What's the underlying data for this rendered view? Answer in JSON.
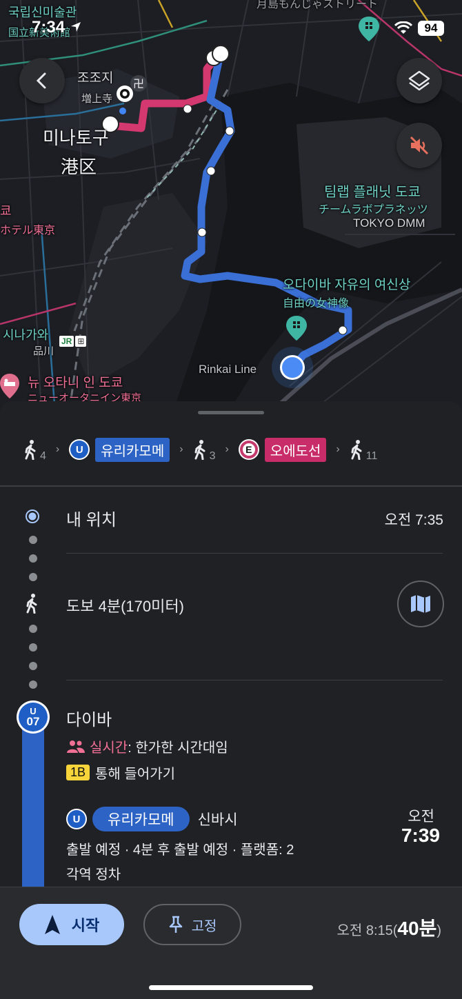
{
  "status_bar": {
    "time": "7:34",
    "battery": "94"
  },
  "map": {
    "labels": {
      "museum_ko": "국립신미술관",
      "museum_ja": "国立新美術館",
      "neighborhood_ja": "月島もんじゃストリート",
      "zojoji_ko": "조조지",
      "zojoji_ja": "増上寺",
      "minato_ko": "미나토구",
      "minato_ja": "港区",
      "teamlab_ko": "팀랩 플래닛 도쿄",
      "teamlab_ja": "チームラボプラネッツ",
      "teamlab_en": "TOKYO DMM",
      "statue_ko": "오다이바 자유의 여신상",
      "statue_ja": "自由の女神像",
      "hotel_ja": "ホテル東京",
      "hotel_prefix": "쿄",
      "shinagawa_ko": "시나가와",
      "shinagawa_ja": "品川",
      "jr": "JR",
      "newotani_ko": "뉴 오타니 인 도쿄",
      "newotani_ja": "ニューオータニイン東京",
      "rinkai": "Rinkai Line"
    },
    "icons": [
      "back-icon",
      "layers-icon",
      "mute-icon",
      "temple-icon",
      "attraction-icon",
      "hotel-icon",
      "train-icon"
    ]
  },
  "summary": {
    "walk1": "4",
    "line1": "유리카모메",
    "line1_badge": "U",
    "walk2": "3",
    "line2": "오에도선",
    "line2_badge": "E",
    "walk3": "11"
  },
  "steps": {
    "origin_label": "내 위치",
    "origin_time": "오전 7:35",
    "walk_label": "도보 4분(170미터)",
    "station_code_line": "U",
    "station_code_num": "07",
    "station_name": "다이바",
    "realtime_label": "실시간",
    "realtime_text": ": 한가한 시간대임",
    "entrance_badge": "1B",
    "entrance_text": "통해 들어가기",
    "line_badge": "U",
    "line_name": "유리카모메",
    "direction": "신바시",
    "departure_ampm": "오전",
    "departure_time": "7:39",
    "departure_info": "출발 예정 · 4분 후 출발 예정 · 플랫폼: 2",
    "service": "각역 정차"
  },
  "bottom": {
    "start_label": "시작",
    "pin_label": "고정",
    "eta_prefix": "오전 8:15(",
    "eta_duration": "40분",
    "eta_suffix": ")"
  },
  "colors": {
    "walk_route": "#d3396f",
    "transit_route": "#3a6fd6",
    "accent": "#a8c7fa",
    "yurikamome": "#2c63c4",
    "oedo": "#c92d69"
  }
}
